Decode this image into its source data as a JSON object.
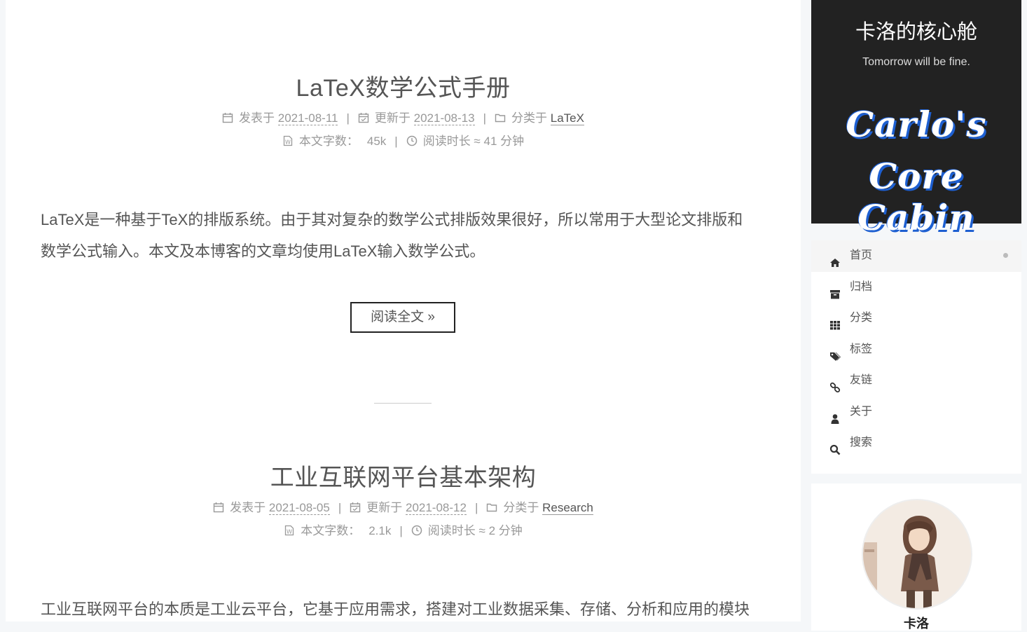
{
  "posts": [
    {
      "title": "LaTeX数学公式手册",
      "posted_label": "发表于",
      "posted_date": "2021-08-11",
      "updated_label": "更新于",
      "updated_date": "2021-08-13",
      "category_label": "分类于",
      "category": "LaTeX",
      "wordcount_label": "本文字数：",
      "wordcount": "45k",
      "readtime_label": "阅读时长 ≈",
      "readtime": "41 分钟",
      "excerpt_line1": "LaTeX是一种基于TeX的排版系统。由于其对复杂的数学公式排版效果很好，所以常用于大型论文排版和",
      "excerpt_line2": "数学公式输入。本文及本博客的文章均使用LaTeX输入数学公式。",
      "read_more": "阅读全文 »"
    },
    {
      "title": "工业互联网平台基本架构",
      "posted_label": "发表于",
      "posted_date": "2021-08-05",
      "updated_label": "更新于",
      "updated_date": "2021-08-12",
      "category_label": "分类于",
      "category": "Research",
      "wordcount_label": "本文字数：",
      "wordcount": "2.1k",
      "readtime_label": "阅读时长 ≈",
      "readtime": "2 分钟",
      "excerpt_line1": "工业互联网平台的本质是工业云平台，它基于应用需求，搭建对工业数据采集、存储、分析和应用的模块"
    }
  ],
  "sidebar": {
    "site_title": "卡洛的核心舱",
    "subtitle": "Tomorrow will be fine.",
    "logo_line1": "Carlo's",
    "logo_line2": "Core Cabin",
    "menu": [
      {
        "label": "首页",
        "icon": "home-icon"
      },
      {
        "label": "归档",
        "icon": "archive-icon"
      },
      {
        "label": "分类",
        "icon": "grid-icon"
      },
      {
        "label": "标签",
        "icon": "tags-icon"
      },
      {
        "label": "友链",
        "icon": "link-icon"
      },
      {
        "label": "关于",
        "icon": "user-icon"
      },
      {
        "label": "搜索",
        "icon": "search-icon"
      }
    ],
    "author_name": "卡洛"
  },
  "colors": {
    "brand_bg": "#222222",
    "logo_outline": "#1d5fd1",
    "text": "#555555",
    "meta": "#999999"
  }
}
